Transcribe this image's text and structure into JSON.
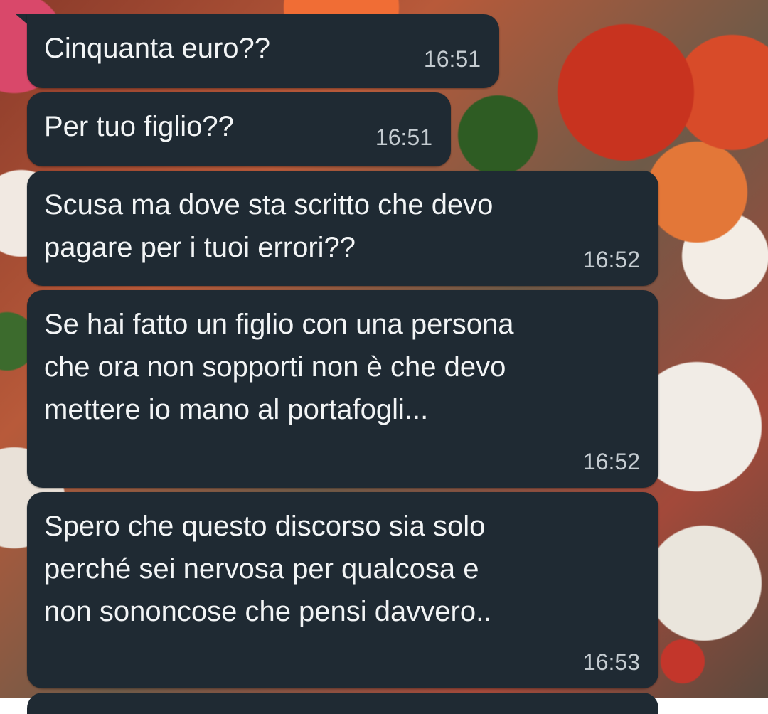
{
  "messages": [
    {
      "text": "Cinquanta euro??",
      "time": "16:51"
    },
    {
      "text": "Per tuo figlio??",
      "time": "16:51"
    },
    {
      "text": "Scusa ma dove sta scritto che devo\npagare per i tuoi errori??",
      "time": "16:52"
    },
    {
      "text": "Se hai fatto un figlio con una persona\nche ora non sopporti non è che devo\nmettere io mano al portafogli...",
      "time": "16:52"
    },
    {
      "text": "Spero che questo discorso sia solo\nperché sei nervosa per qualcosa e\nnon sononcose che pensi davvero..",
      "time": "16:53"
    }
  ],
  "colors": {
    "bubble": "#1f2a33",
    "text": "#f2f4f5",
    "timestamp": "#c5ccd1"
  }
}
